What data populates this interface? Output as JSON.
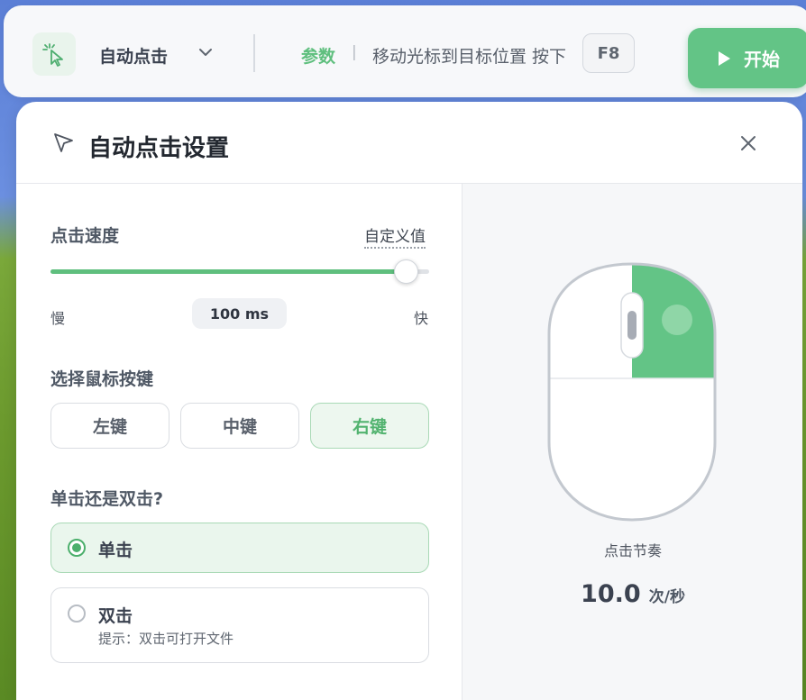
{
  "toolbar": {
    "mode_label": "自动点击",
    "params_label": "参数",
    "separator": "|",
    "hint": "移动光标到目标位置 按下",
    "hotkey": "F8",
    "start_label": "开始"
  },
  "dialog": {
    "title": "自动点击设置",
    "speed": {
      "label": "点击速度",
      "custom_link": "自定义值",
      "slow_label": "慢",
      "fast_label": "快",
      "value_text": "100 ms",
      "slider_fraction": 0.94
    },
    "mouse_button": {
      "label": "选择鼠标按键",
      "options": [
        "左键",
        "中键",
        "右键"
      ],
      "selected": "右键"
    },
    "click_type": {
      "label": "单击还是双击?",
      "options": [
        {
          "title": "单击",
          "sub": "",
          "selected": true
        },
        {
          "title": "双击",
          "sub": "提示：双击可打开文件",
          "selected": false
        }
      ]
    },
    "preview": {
      "rhythm_label": "点击节奏",
      "rate_value": "10.0",
      "rate_unit": "次/秒",
      "highlight_button": "right"
    }
  },
  "colors": {
    "accent": "#5fbf7e",
    "selected_bg": "#edf7ef",
    "text_dark": "#232830"
  },
  "icons": {
    "mode": "cursor-click-icon",
    "chevron": "chevron-down-icon",
    "play": "play-icon",
    "header": "cursor-arrow-icon",
    "close": "close-icon"
  }
}
